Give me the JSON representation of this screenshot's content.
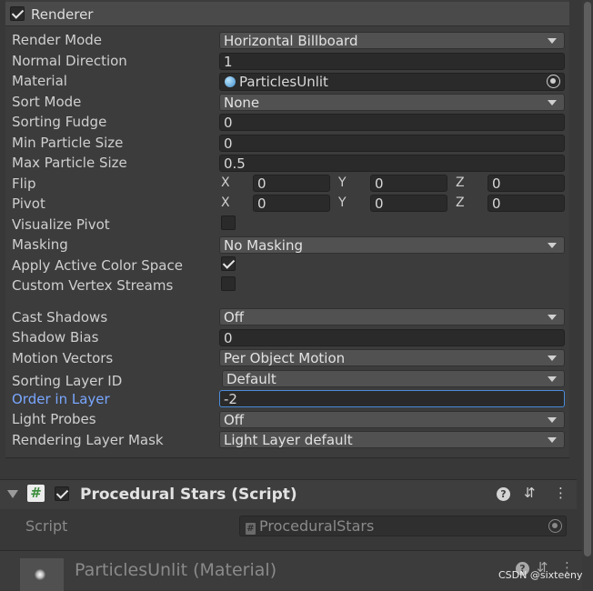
{
  "renderer": {
    "title": "Renderer",
    "enabled": true,
    "fields": {
      "render_mode": {
        "label": "Render Mode",
        "value": "Horizontal Billboard"
      },
      "normal_direction": {
        "label": "Normal Direction",
        "value": "1"
      },
      "material": {
        "label": "Material",
        "value": "ParticlesUnlit"
      },
      "sort_mode": {
        "label": "Sort Mode",
        "value": "None"
      },
      "sorting_fudge": {
        "label": "Sorting Fudge",
        "value": "0"
      },
      "min_particle_size": {
        "label": "Min Particle Size",
        "value": "0"
      },
      "max_particle_size": {
        "label": "Max Particle Size",
        "value": "0.5"
      },
      "flip": {
        "label": "Flip",
        "x_label": "X",
        "y_label": "Y",
        "z_label": "Z",
        "x": "0",
        "y": "0",
        "z": "0"
      },
      "pivot": {
        "label": "Pivot",
        "x_label": "X",
        "y_label": "Y",
        "z_label": "Z",
        "x": "0",
        "y": "0",
        "z": "0"
      },
      "visualize_pivot": {
        "label": "Visualize Pivot",
        "checked": false
      },
      "masking": {
        "label": "Masking",
        "value": "No Masking"
      },
      "apply_active_color_space": {
        "label": "Apply Active Color Space",
        "checked": true
      },
      "custom_vertex_streams": {
        "label": "Custom Vertex Streams",
        "checked": false
      },
      "cast_shadows": {
        "label": "Cast Shadows",
        "value": "Off"
      },
      "shadow_bias": {
        "label": "Shadow Bias",
        "value": "0"
      },
      "motion_vectors": {
        "label": "Motion Vectors",
        "value": "Per Object Motion"
      },
      "sorting_layer_id": {
        "label": "Sorting Layer ID",
        "value": "Default"
      },
      "order_in_layer": {
        "label": "Order in Layer",
        "value": "-2"
      },
      "light_probes": {
        "label": "Light Probes",
        "value": "Off"
      },
      "rendering_layer_mask": {
        "label": "Rendering Layer Mask",
        "value": "Light Layer default"
      }
    }
  },
  "script_component": {
    "title": "Procedural Stars (Script)",
    "enabled": true,
    "script_label": "Script",
    "script_value": "ProceduralStars",
    "hash_glyph": "#"
  },
  "material_section": {
    "title": "ParticlesUnlit (Material)"
  },
  "icons": {
    "help": "?",
    "presets": "⇵",
    "more": "⋮"
  },
  "watermark": "CSDN @sixteenyy",
  "colors": {
    "background": "#383838",
    "active_label": "#7aa7ff",
    "focus_border": "#4b8bda"
  }
}
